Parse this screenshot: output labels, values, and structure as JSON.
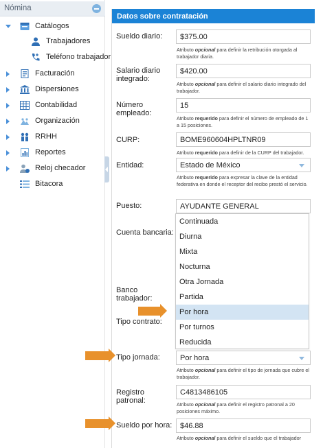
{
  "sidebar": {
    "title": "Nómina",
    "items": [
      {
        "label": "Catálogos",
        "icon": "folder-icon"
      },
      {
        "label": "Trabajadores",
        "icon": "user-icon"
      },
      {
        "label": "Teléfono trabajador",
        "icon": "phone-icon"
      },
      {
        "label": "Facturación",
        "icon": "invoice-icon"
      },
      {
        "label": "Dispersiones",
        "icon": "bank-icon"
      },
      {
        "label": "Contabilidad",
        "icon": "ledger-icon"
      },
      {
        "label": "Organización",
        "icon": "organization-icon"
      },
      {
        "label": "RRHH",
        "icon": "people-icon"
      },
      {
        "label": "Reportes",
        "icon": "report-icon"
      },
      {
        "label": "Reloj checador",
        "icon": "clock-user-icon"
      },
      {
        "label": "Bitacora",
        "icon": "list-icon"
      }
    ]
  },
  "panel": {
    "title": "Datos sobre contratación",
    "fields": {
      "sueldo_diario": {
        "label": "Sueldo diario:",
        "value": "$375.00",
        "help_pre": "Atributo ",
        "help_kw": "opcional",
        "help_post": " para definir la retribución otorgada al trabajador diaria."
      },
      "salario_integrado": {
        "label": "Salario diario integrado:",
        "value": "$420.00",
        "help_pre": "Atributo ",
        "help_kw": "opcional",
        "help_post": " para definir el salario diario integrado del trabajador."
      },
      "numero_empleado": {
        "label": "Número empleado:",
        "value": "15",
        "help_pre": "Atributo ",
        "help_kw": "requerido",
        "help_post": " para definir el número de empleado de 1 a 15 posiciones."
      },
      "curp": {
        "label": "CURP:",
        "value": "BOME960604HPLTNR09",
        "help_pre": "Atributo ",
        "help_kw": "requerido",
        "help_post": " para definir de la CURP del trabajador."
      },
      "entidad": {
        "label": "Entidad:",
        "value": "Estado de México",
        "help_pre": "Atributo ",
        "help_kw": "requerido",
        "help_post": " para expresar la clave de la entidad federativa en donde el receptor del recibo prestó el servicio."
      },
      "puesto": {
        "label": "Puesto:",
        "value": "AYUDANTE GENERAL"
      },
      "cuenta_bancaria": {
        "label": "Cuenta bancaria:"
      },
      "banco_trabajador": {
        "label": "Banco trabajador:"
      },
      "tipo_contrato": {
        "label": "Tipo contrato:"
      },
      "tipo_jornada": {
        "label": "Tipo jornada:",
        "value": "Por hora",
        "help_pre": "Atributo ",
        "help_kw": "opcional",
        "help_post": " para definir el tipo de jornada que cubre el trabajador."
      },
      "registro_patronal": {
        "label": "Registro patronal:",
        "value": "C4813486105",
        "help_pre": "Atributo ",
        "help_kw": "opcional",
        "help_post": " para definir el registro patronal a 20 posiciones máximo."
      },
      "sueldo_por_hora": {
        "label": "Sueldo por hora:",
        "value": "$46.88",
        "help_pre": "Atributo ",
        "help_kw": "opcional",
        "help_post": " para definir el sueldo que el trabajador"
      }
    },
    "jornada_options": [
      "Continuada",
      "Diurna",
      "Mixta",
      "Nocturna",
      "Otra Jornada",
      "Partida",
      "Por hora",
      "Por turnos",
      "Reducida"
    ],
    "highlighted_option": "Por hora"
  },
  "colors": {
    "header": "#1b83d6",
    "accent_arrow": "#e8912c",
    "highlight": "#d3e4f3"
  }
}
